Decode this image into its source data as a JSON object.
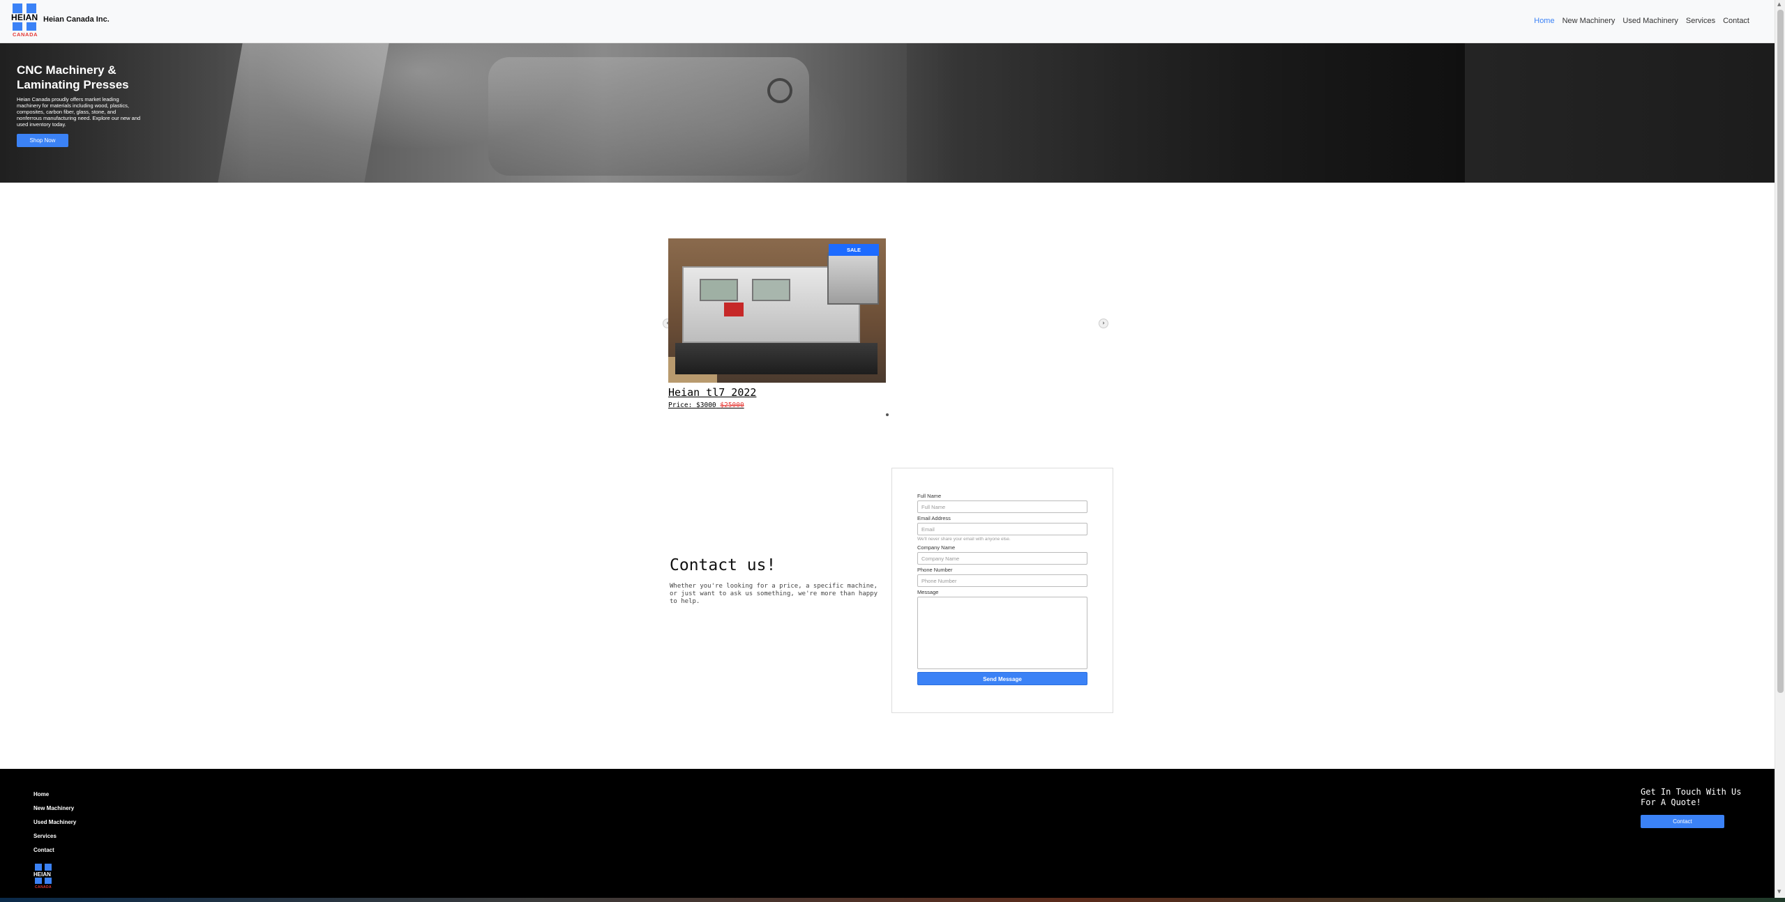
{
  "navbar": {
    "logo_word": "HEIAN",
    "logo_sub": "CANADA",
    "brand_name": "Heian Canada Inc.",
    "links": [
      "Home",
      "New Machinery",
      "Used Machinery",
      "Services",
      "Contact"
    ],
    "active_link": "Home"
  },
  "hero": {
    "title": "CNC Machinery & Laminating Presses",
    "description": "Heian Canada proudly offers market leading machinery for materials including wood, plastics, composites, carbon fiber, glass, stone, and nonferrous manufacturing need. Explore our new and used inventory today.",
    "button_label": "Shop Now"
  },
  "carousel": {
    "prev_icon": "‹",
    "next_icon": "›",
    "items": [
      {
        "badge": "SALE",
        "title": "Heian tl7 2022",
        "price_label": "Price: $3000",
        "old_price": "$25000"
      }
    ]
  },
  "contact": {
    "heading": "Contact us!",
    "text": "Whether you're looking for a price, a specific machine, or just want to ask us something, we're more than happy to help.",
    "form": {
      "full_name_label": "Full Name",
      "full_name_placeholder": "Full Name",
      "email_label": "Email Address",
      "email_placeholder": "Email",
      "email_help": "We'll never share your email with anyone else.",
      "company_label": "Company Name",
      "company_placeholder": "Company Name",
      "phone_label": "Phone Number",
      "phone_placeholder": "Phone Number",
      "message_label": "Message",
      "submit_label": "Send Message"
    }
  },
  "footer": {
    "links": [
      "Home",
      "New Machinery",
      "Used Machinery",
      "Services",
      "Contact"
    ],
    "logo_word": "HEIAN",
    "logo_sub": "CANADA",
    "quote_heading": "Get In Touch With Us For A Quote!",
    "contact_button": "Contact"
  },
  "colors": {
    "accent": "#3b82f6",
    "sale_badge": "#1d6bff",
    "old_price": "#e53935",
    "footer_bg": "#000000"
  }
}
